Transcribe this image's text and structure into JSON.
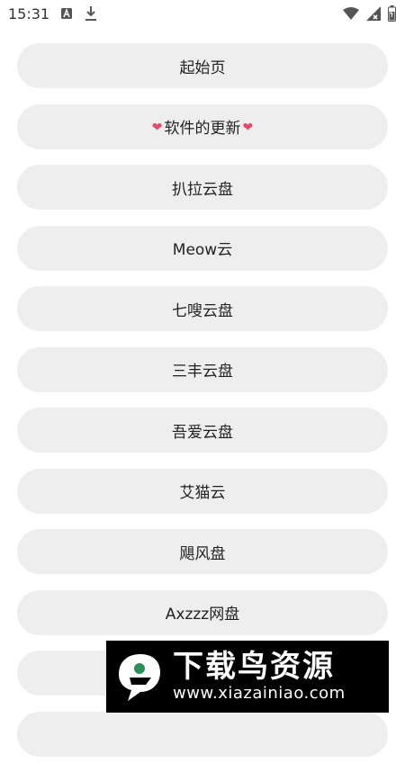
{
  "status_bar": {
    "time": "15:31",
    "icons": [
      "a-icon",
      "download-icon",
      "wifi-icon",
      "signal-icon",
      "battery-icon"
    ]
  },
  "menu": {
    "items": [
      {
        "label": "起始页"
      },
      {
        "label": "软件的更新",
        "decoration": "heart-icon"
      },
      {
        "label": "扒拉云盘"
      },
      {
        "label": "Meow云"
      },
      {
        "label": "七嗖云盘"
      },
      {
        "label": "三丰云盘"
      },
      {
        "label": "吾爱云盘"
      },
      {
        "label": "艾猫云"
      },
      {
        "label": "飓风盘"
      },
      {
        "label": "Axzzz网盘"
      },
      {
        "label": ""
      },
      {
        "label": ""
      }
    ]
  },
  "watermark": {
    "title": "下载鸟资源",
    "url": "www.xiazainiao.com"
  }
}
